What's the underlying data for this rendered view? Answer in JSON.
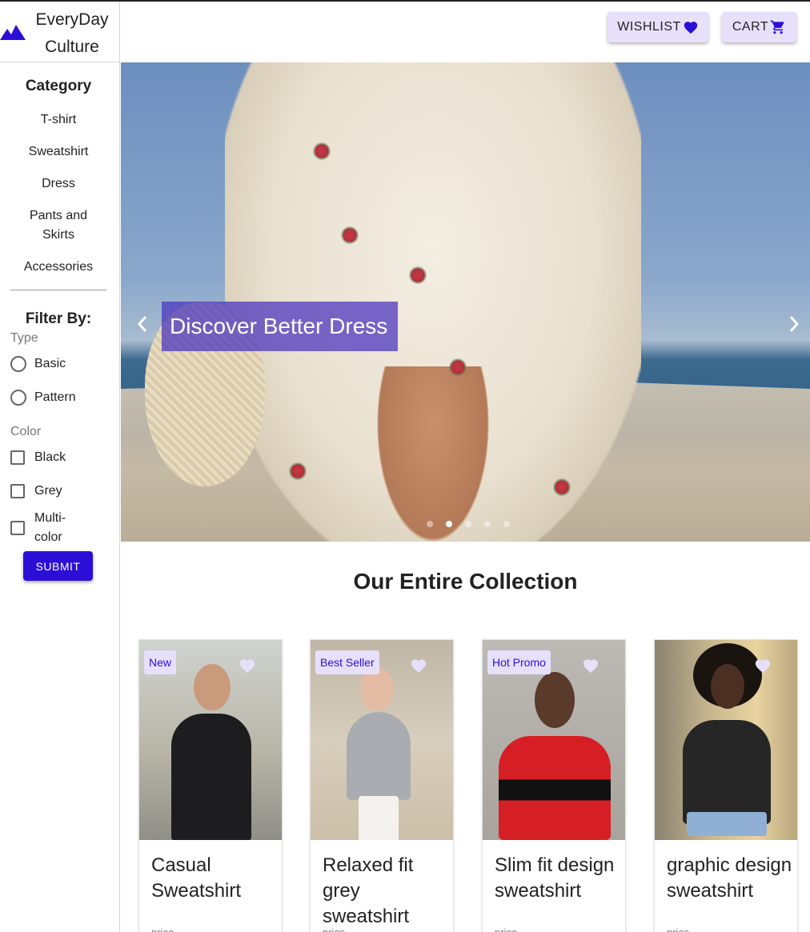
{
  "brand": {
    "line1": "EveryDay",
    "line2": "Culture",
    "accent": "#2b0fd7"
  },
  "header": {
    "wishlist_label": "WISHLIST",
    "cart_label": "CART"
  },
  "sidebar": {
    "category_title": "Category",
    "categories": [
      "T-shirt",
      "Sweatshirt",
      "Dress",
      "Pants and Skirts",
      "Accessories"
    ],
    "filter_title": "Filter By:",
    "type_label": "Type",
    "type_options": [
      "Basic",
      "Pattern"
    ],
    "color_label": "Color",
    "color_options": [
      "Black",
      "Grey",
      "Multi-color"
    ],
    "submit_label": "SUBMIT"
  },
  "hero": {
    "caption": "Discover Better Dress",
    "slide_count": 5,
    "active_slide": 2
  },
  "collection": {
    "title": "Our Entire Collection",
    "products": [
      {
        "badge": "New",
        "name": "Casual Sweatshirt",
        "price": "price"
      },
      {
        "badge": "Best Seller",
        "name": "Relaxed fit grey sweatshirt",
        "price": "price"
      },
      {
        "badge": "Hot Promo",
        "name": "Slim fit design sweatshirt",
        "price": "price"
      },
      {
        "badge": "",
        "name": "graphic design sweatshirt",
        "price": "price"
      }
    ]
  }
}
